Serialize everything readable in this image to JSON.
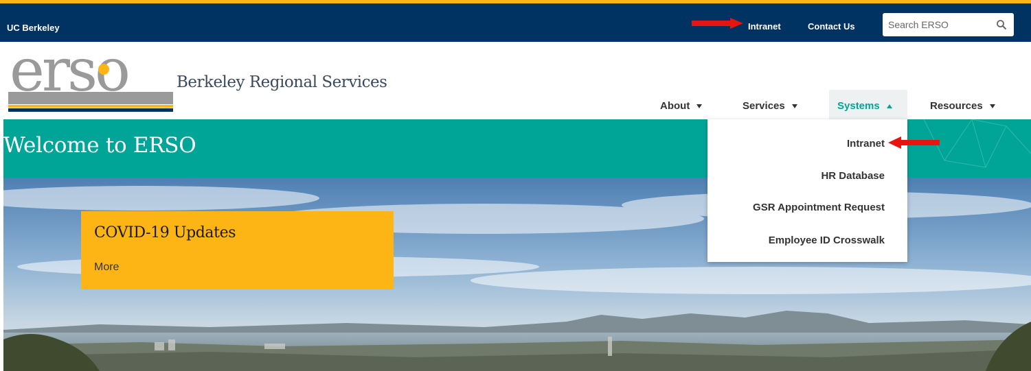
{
  "topbar": {
    "brand": "UC Berkeley",
    "intranet_label": "Intranet",
    "contact_label": "Contact Us",
    "search_placeholder": "Search ERSO"
  },
  "logo": {
    "wordmark": "erso",
    "title": "Berkeley Regional Services"
  },
  "nav": {
    "items": [
      {
        "label": "About"
      },
      {
        "label": "Services"
      },
      {
        "label": "Systems",
        "active": true
      },
      {
        "label": "Resources"
      }
    ]
  },
  "banner": {
    "title": "Welcome to ERSO"
  },
  "feature": {
    "title": "COVID-19 Updates",
    "link": "More"
  },
  "dropdown": {
    "items": [
      {
        "label": "Intranet"
      },
      {
        "label": "HR Database"
      },
      {
        "label": "GSR Appointment Request"
      },
      {
        "label": "Employee ID Crosswalk"
      }
    ]
  },
  "colors": {
    "navy": "#003262",
    "gold": "#FDB515",
    "teal": "#00A598",
    "annotation_red": "#E8140F"
  },
  "icons": [
    "search-icon",
    "caret-down-icon",
    "caret-up-icon",
    "red-arrow-annotation"
  ]
}
